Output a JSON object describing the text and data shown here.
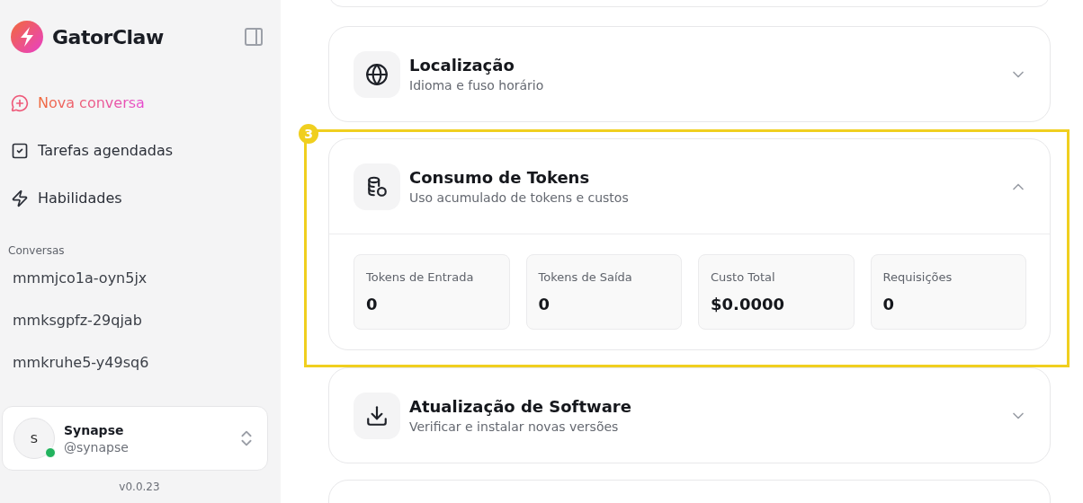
{
  "sidebar": {
    "brand": "GatorClaw",
    "nav": [
      {
        "label": "Nova conversa",
        "kind": "primary"
      },
      {
        "label": "Tarefas agendadas",
        "kind": "plain"
      },
      {
        "label": "Habilidades",
        "kind": "plain"
      }
    ],
    "conversations_heading": "Conversas",
    "conversations": [
      "mmmjco1a-oyn5jx",
      "mmksgpfz-29qjab",
      "mmkruhe5-y49sq6"
    ],
    "user": {
      "initial": "S",
      "name": "Synapse",
      "handle": "@synapse",
      "online": true
    },
    "version": "v0.0.23"
  },
  "highlight": {
    "badge": "3"
  },
  "sections": [
    {
      "title": "Localização",
      "subtitle": "Idioma e fuso horário",
      "expanded": false,
      "highlighted": false
    },
    {
      "title": "Consumo de Tokens",
      "subtitle": "Uso acumulado de tokens e custos",
      "expanded": true,
      "highlighted": true,
      "stats": [
        {
          "label": "Tokens de Entrada",
          "value": "0"
        },
        {
          "label": "Tokens de Saída",
          "value": "0"
        },
        {
          "label": "Custo Total",
          "value": "$0.0000"
        },
        {
          "label": "Requisições",
          "value": "0"
        }
      ]
    },
    {
      "title": "Atualização de Software",
      "subtitle": "Verificar e instalar novas versões",
      "expanded": false,
      "highlighted": false
    }
  ]
}
